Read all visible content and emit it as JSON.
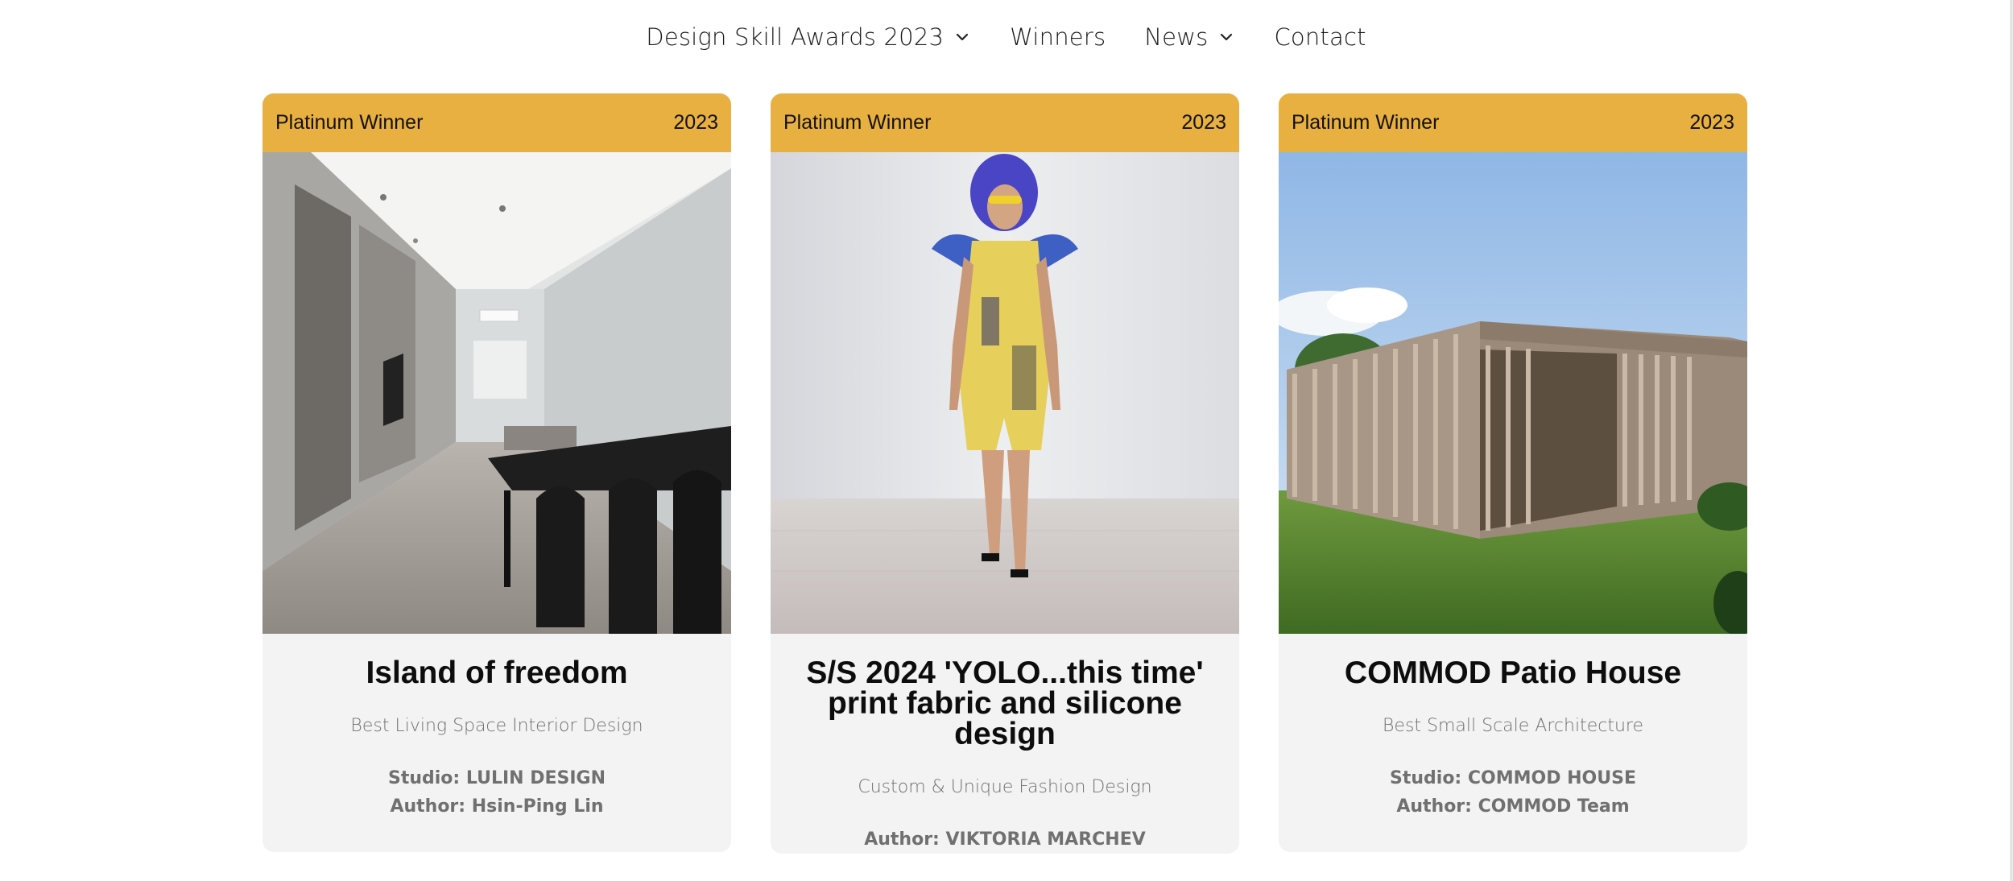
{
  "nav": {
    "items": [
      {
        "label": "Design Skill Awards 2023",
        "has_dropdown": true
      },
      {
        "label": "Winners",
        "has_dropdown": false
      },
      {
        "label": "News",
        "has_dropdown": true
      },
      {
        "label": "Contact",
        "has_dropdown": false
      }
    ]
  },
  "colors": {
    "accent": "#e8b041",
    "card_bg": "#f3f3f3",
    "muted_text": "#707070"
  },
  "cards": [
    {
      "badge": "Platinum Winner",
      "year": "2023",
      "image_icon": "interior-photo",
      "title": "Island of freedom",
      "category": "Best Living Space Interior Design",
      "studio": "Studio: LULIN DESIGN",
      "author": "Author: Hsin-Ping Lin"
    },
    {
      "badge": "Platinum Winner",
      "year": "2023",
      "image_icon": "fashion-runway-photo",
      "title": "S/S 2024 'YOLO...this time' print fabric and silicone design",
      "category": "Custom & Unique Fashion Design",
      "author": "Author: VIKTORIA MARCHEV"
    },
    {
      "badge": "Platinum Winner",
      "year": "2023",
      "image_icon": "architecture-photo",
      "title": "COMMOD Patio House",
      "category": "Best Small Scale Architecture",
      "studio": "Studio: COMMOD HOUSE",
      "author": "Author: COMMOD Team"
    }
  ]
}
